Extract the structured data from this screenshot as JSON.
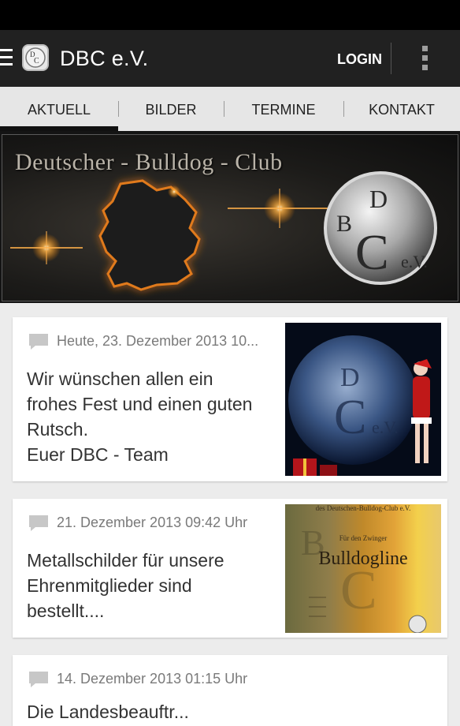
{
  "app": {
    "title": "DBC e.V.",
    "login_label": "LOGIN",
    "menu_icon": "hamburger-menu-icon",
    "overflow_icon": "overflow-menu-icon",
    "logo_icon": "club-logo"
  },
  "tabs": [
    {
      "label": "AKTUELL",
      "selected": true
    },
    {
      "label": "BILDER",
      "selected": false
    },
    {
      "label": "TERMINE",
      "selected": false
    },
    {
      "label": "KONTAKT",
      "selected": false
    }
  ],
  "banner": {
    "title": "Deutscher - Bulldog - Club",
    "logo_text": "DBC e.V."
  },
  "posts": [
    {
      "date": "Heute, 23. Dezember 2013 10...",
      "text": [
        "Wir wünschen allen ein",
        "frohes Fest und einen guten",
        "Rutsch.",
        "Euer DBC - Team"
      ],
      "image": "christmas-dbc-emblem"
    },
    {
      "date": "21. Dezember 2013 09:42 Uhr",
      "text": [
        "Metallschilder für unsere",
        "Ehrenmitglieder sind",
        "bestellt...."
      ],
      "image": "bulldogline-certificate",
      "image_text": {
        "header": "des Deutschen-Bulldog-Club e.V.",
        "subheader": "Für den Zwinger",
        "name": "Bulldogline"
      }
    },
    {
      "date": "14. Dezember 2013 01:15 Uhr",
      "text": [
        "Die Landesbeauftr..."
      ]
    }
  ],
  "colors": {
    "appbar": "#212121",
    "statusbar": "#000000",
    "tab_background": "#e6e6e6",
    "page_background": "#ececec",
    "date_text": "#7a7a7a"
  }
}
